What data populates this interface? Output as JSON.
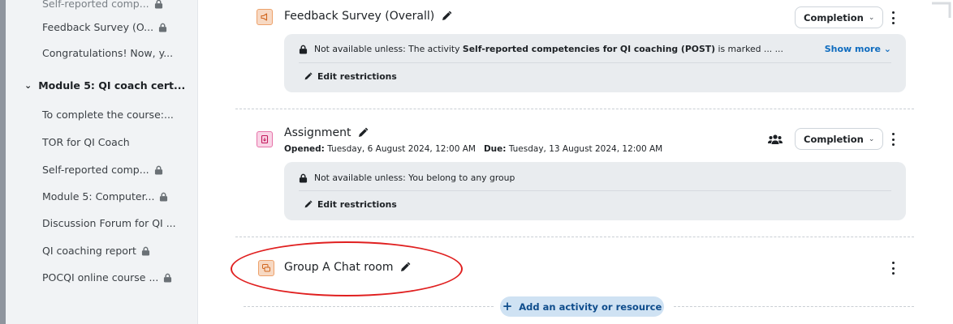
{
  "course_index": {
    "items_before": [
      {
        "label": "Self-reported comp...",
        "locked": true
      },
      {
        "label": "Feedback Survey (O...",
        "locked": true
      },
      {
        "label": "Congratulations! Now, y...",
        "locked": false
      }
    ],
    "section": {
      "label": "Module 5: QI coach cert...",
      "expanded": true
    },
    "items": [
      {
        "label": "To complete the course:...",
        "locked": false
      },
      {
        "label": "TOR for QI Coach",
        "locked": false
      },
      {
        "label": "Self-reported comp...",
        "locked": true
      },
      {
        "label": "Module 5: Computer...",
        "locked": true
      },
      {
        "label": "Discussion Forum for QI ...",
        "locked": false
      },
      {
        "label": "QI coaching report",
        "locked": true
      },
      {
        "label": "POCQI online course ...",
        "locked": true
      }
    ]
  },
  "activities": {
    "feedback": {
      "title": "Feedback Survey (Overall)",
      "icon": "feedback-icon",
      "completion_label": "Completion",
      "restriction_prefix": "Not available unless: The activity",
      "restriction_activity": "Self-reported competencies for QI coaching (POST)",
      "restriction_suffix": "is marked ... ...",
      "show_more": "Show more",
      "edit_restrictions": "Edit restrictions"
    },
    "assignment": {
      "title": "Assignment",
      "icon": "assignment-icon",
      "opened_label": "Opened:",
      "opened_value": "Tuesday, 6 August 2024, 12:00 AM",
      "due_label": "Due:",
      "due_value": "Tuesday, 13 August 2024, 12:00 AM",
      "completion_label": "Completion",
      "restriction": "Not available unless: You belong to any group",
      "edit_restrictions": "Edit restrictions"
    },
    "chat": {
      "title": "Group A Chat room",
      "icon": "chat-icon"
    }
  },
  "add_activity_label": "Add an activity or resource",
  "colors": {
    "accent": "#0f6cbf",
    "feedback_icon_bg": "#f7d9c3",
    "assignment_icon_bg": "#f9d4e6",
    "highlight": "#e02020"
  }
}
